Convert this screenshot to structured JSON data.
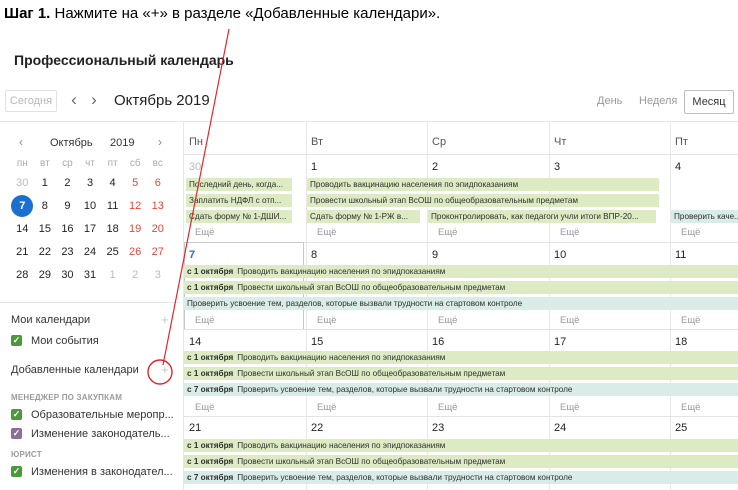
{
  "instruction": {
    "step": "Шаг 1.",
    "text": " Нажмите на «+» в разделе «Добавленные календари»."
  },
  "app_title": "Профессиональный календарь",
  "toolbar": {
    "today": "Сегодня",
    "month_title": "Октябрь 2019",
    "views": {
      "day": "День",
      "week": "Неделя",
      "month": "Месяц"
    }
  },
  "mini": {
    "month": "Октябрь",
    "year": "2019",
    "dow": [
      "пн",
      "вт",
      "ср",
      "чт",
      "пт",
      "сб",
      "вс"
    ],
    "weeks": [
      [
        "30",
        "1",
        "2",
        "3",
        "4",
        "5",
        "6"
      ],
      [
        "7",
        "8",
        "9",
        "10",
        "11",
        "12",
        "13"
      ],
      [
        "14",
        "15",
        "16",
        "17",
        "18",
        "19",
        "20"
      ],
      [
        "21",
        "22",
        "23",
        "24",
        "25",
        "26",
        "27"
      ],
      [
        "28",
        "29",
        "30",
        "31",
        "1",
        "2",
        "3"
      ]
    ]
  },
  "sidebar": {
    "my_calendars": "Мои календари",
    "my_events": "Мои события",
    "added_calendars": "Добавленные календари",
    "group1": "МЕНЕДЖЕР ПО ЗАКУПКАМ",
    "group1_items": [
      "Образовательные меропр...",
      "Изменение законодатель..."
    ],
    "group2": "ЮРИСТ",
    "group2_items": [
      "Изменения в законодател..."
    ],
    "colors": {
      "green": "#4a9a3c",
      "purple": "#8d6e99"
    }
  },
  "grid": {
    "dow": [
      "Пн",
      "Вт",
      "Ср",
      "Чт",
      "Пт"
    ],
    "weeks": [
      [
        "30",
        "1",
        "2",
        "3",
        "4"
      ],
      [
        "7",
        "8",
        "9",
        "10",
        "11"
      ],
      [
        "14",
        "15",
        "16",
        "17",
        "18"
      ],
      [
        "21",
        "22",
        "23",
        "24",
        "25"
      ]
    ],
    "more": "Ещё",
    "week1_events": {
      "mon1": "Последний день, когда...",
      "mon2": "Заплатить НДФЛ с отп...",
      "mon3": "Сдать форму № 1-ДШИ...",
      "tue1": "Проводить вакцинацию населения по эпидпоказаниям",
      "tue2": "Провести школьный этап ВсОШ по общеобразовательным предметам",
      "tue3": "Сдать форму № 1-РЖ в...",
      "wed3": "Проконтролировать, как педагоги учли итоги ВПР-20...",
      "fri3": "Проверить каче..."
    },
    "span_date1": "с 1 октября",
    "span_date7": "с 7 октября",
    "span_vac": "Проводить вакцинацию населения по эпидпоказаниям",
    "span_vsosh": "Провести школьный этап ВсОШ по общеобразовательным предметам",
    "span_check": "Проверить усвоение тем, разделов, которые вызвали трудности на стартовом контроле"
  },
  "colors": {
    "accent": "#1a6fd1",
    "event_green": "#ddebc4",
    "event_teal": "#d9ece8",
    "annotation_red": "#e0282c",
    "weekend_red": "#e5463a"
  }
}
